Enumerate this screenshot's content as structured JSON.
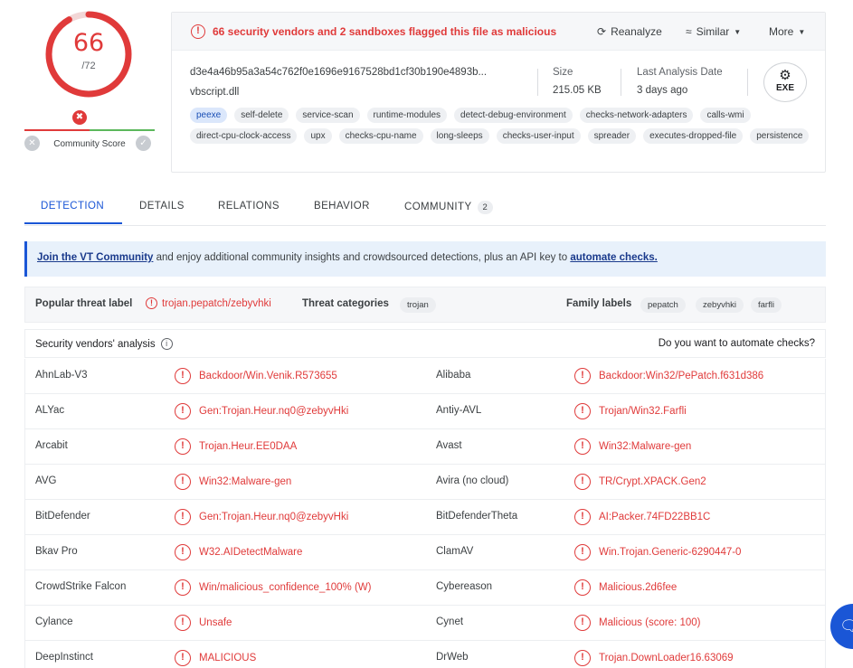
{
  "score": {
    "detected": "66",
    "total": "/72",
    "ratio": 0.9167,
    "color": "#e03a3a"
  },
  "community": {
    "label": "Community Score",
    "marker": "✖"
  },
  "summary": {
    "alert": "66 security vendors and 2 sandboxes flagged this file as malicious",
    "actions": {
      "reanalyze": "Reanalyze",
      "similar": "Similar",
      "more": "More"
    },
    "hash": "d3e4a46b95a3a54c762f0e1696e9167528bd1cf30b190e4893b...",
    "filename": "vbscript.dll",
    "size_label": "Size",
    "size_value": "215.05 KB",
    "last_label": "Last Analysis Date",
    "last_value": "3 days ago",
    "filetype": "EXE",
    "tags": [
      "peexe",
      "self-delete",
      "service-scan",
      "runtime-modules",
      "detect-debug-environment",
      "checks-network-adapters",
      "calls-wmi",
      "direct-cpu-clock-access",
      "upx",
      "checks-cpu-name",
      "long-sleeps",
      "checks-user-input",
      "spreader",
      "executes-dropped-file",
      "persistence"
    ]
  },
  "tabs": {
    "detection": "DETECTION",
    "details": "DETAILS",
    "relations": "RELATIONS",
    "behavior": "BEHAVIOR",
    "community": "COMMUNITY",
    "community_count": "2"
  },
  "banner": {
    "link1": "Join the VT Community",
    "middle": " and enjoy additional community insights and crowdsourced detections, plus an API key to ",
    "link2": "automate checks."
  },
  "labels": {
    "popular_title": "Popular threat label",
    "popular_value": "trojan.pepatch/zebyvhki",
    "categories_title": "Threat categories",
    "categories": [
      "trojan"
    ],
    "family_title": "Family labels",
    "families": [
      "pepatch",
      "zebyvhki",
      "farfli"
    ]
  },
  "vendors_head": {
    "title": "Security vendors' analysis",
    "right": "Do you want to automate checks?"
  },
  "vendors": [
    {
      "left_name": "AhnLab-V3",
      "left_result": "Backdoor/Win.Venik.R573655",
      "right_name": "Alibaba",
      "right_result": "Backdoor:Win32/PePatch.f631d386"
    },
    {
      "left_name": "ALYac",
      "left_result": "Gen:Trojan.Heur.nq0@zebyvHki",
      "right_name": "Antiy-AVL",
      "right_result": "Trojan/Win32.Farfli"
    },
    {
      "left_name": "Arcabit",
      "left_result": "Trojan.Heur.EE0DAA",
      "right_name": "Avast",
      "right_result": "Win32:Malware-gen"
    },
    {
      "left_name": "AVG",
      "left_result": "Win32:Malware-gen",
      "right_name": "Avira (no cloud)",
      "right_result": "TR/Crypt.XPACK.Gen2"
    },
    {
      "left_name": "BitDefender",
      "left_result": "Gen:Trojan.Heur.nq0@zebyvHki",
      "right_name": "BitDefenderTheta",
      "right_result": "AI:Packer.74FD22BB1C"
    },
    {
      "left_name": "Bkav Pro",
      "left_result": "W32.AIDetectMalware",
      "right_name": "ClamAV",
      "right_result": "Win.Trojan.Generic-6290447-0"
    },
    {
      "left_name": "CrowdStrike Falcon",
      "left_result": "Win/malicious_confidence_100% (W)",
      "right_name": "Cybereason",
      "right_result": "Malicious.2d6fee"
    },
    {
      "left_name": "Cylance",
      "left_result": "Unsafe",
      "right_name": "Cynet",
      "right_result": "Malicious (score: 100)"
    },
    {
      "left_name": "DeepInstinct",
      "left_result": "MALICIOUS",
      "right_name": "DrWeb",
      "right_result": "Trojan.DownLoader16.63069"
    }
  ],
  "icons": {
    "alert": "alert-circle-icon",
    "reanalyze": "refresh-icon",
    "similar": "similar-icon",
    "info": "info-icon",
    "chat": "chat-icon"
  }
}
